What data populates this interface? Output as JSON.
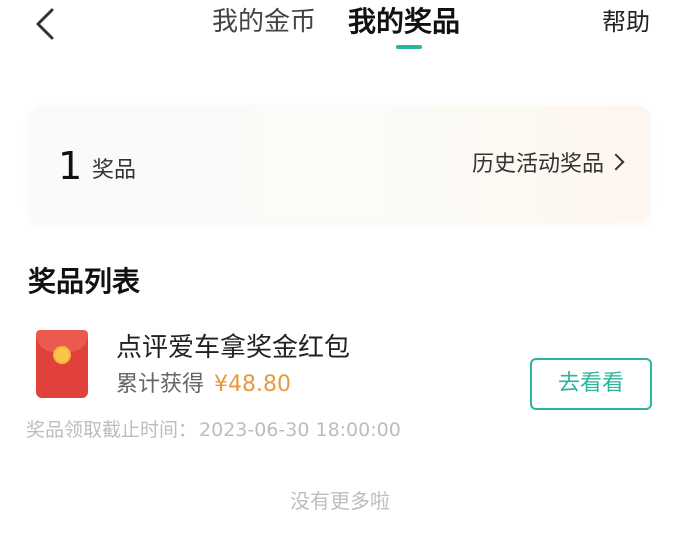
{
  "header": {
    "tab_coins": "我的金币",
    "tab_prizes": "我的奖品",
    "help": "帮助",
    "accent": "#2bb59a"
  },
  "summary": {
    "count": "1",
    "count_label": "奖品",
    "history_link": "历史活动奖品"
  },
  "prize_list": {
    "title": "奖品列表",
    "items": [
      {
        "name": "点评爱车拿奖金红包",
        "accum_label": "累计获得",
        "amount": "¥48.80",
        "button": "去看看",
        "deadline_label": "奖品领取截止时间：",
        "deadline": "2023-06-30 18:00:00",
        "icon": "red-envelope-icon"
      }
    ]
  },
  "footer": {
    "text": "没有更多啦"
  }
}
